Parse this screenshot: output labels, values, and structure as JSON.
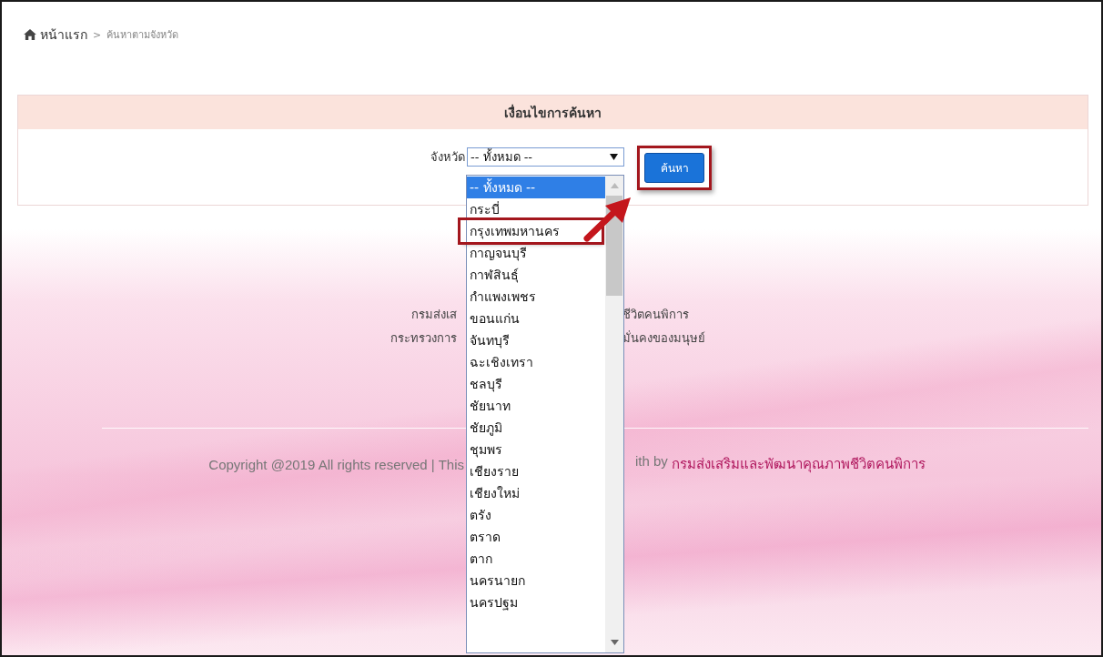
{
  "breadcrumb": {
    "items": [
      {
        "label": "หน้าแรก",
        "kind": "home"
      },
      {
        "label": "ค้นหาตามจังหวัด",
        "kind": "current"
      }
    ],
    "separator": ">"
  },
  "search_panel": {
    "title": "เงื่อนไขการค้นหา",
    "province_label": "จังหวัด",
    "select_value": "-- ทั้งหมด --",
    "button": {
      "label": "ค้นหา",
      "highlighted": true
    }
  },
  "dropdown": {
    "options": [
      {
        "label": "-- ทั้งหมด --",
        "selected": true,
        "highlighted": false
      },
      {
        "label": "กระบี่",
        "selected": false,
        "highlighted": false
      },
      {
        "label": "กรุงเทพมหานคร",
        "selected": false,
        "highlighted": true
      },
      {
        "label": "กาญจนบุรี",
        "selected": false,
        "highlighted": false
      },
      {
        "label": "กาฬสินธุ์",
        "selected": false,
        "highlighted": false
      },
      {
        "label": "กำแพงเพชร",
        "selected": false,
        "highlighted": false
      },
      {
        "label": "ขอนแก่น",
        "selected": false,
        "highlighted": false
      },
      {
        "label": "จันทบุรี",
        "selected": false,
        "highlighted": false
      },
      {
        "label": "ฉะเชิงเทรา",
        "selected": false,
        "highlighted": false
      },
      {
        "label": "ชลบุรี",
        "selected": false,
        "highlighted": false
      },
      {
        "label": "ชัยนาท",
        "selected": false,
        "highlighted": false
      },
      {
        "label": "ชัยภูมิ",
        "selected": false,
        "highlighted": false
      },
      {
        "label": "ชุมพร",
        "selected": false,
        "highlighted": false
      },
      {
        "label": "เชียงราย",
        "selected": false,
        "highlighted": false
      },
      {
        "label": "เชียงใหม่",
        "selected": false,
        "highlighted": false
      },
      {
        "label": "ตรัง",
        "selected": false,
        "highlighted": false
      },
      {
        "label": "ตราด",
        "selected": false,
        "highlighted": false
      },
      {
        "label": "ตาก",
        "selected": false,
        "highlighted": false
      },
      {
        "label": "นครนายก",
        "selected": false,
        "highlighted": false
      },
      {
        "label": "นครปฐม",
        "selected": false,
        "highlighted": false
      }
    ]
  },
  "footer": {
    "lines": [
      {
        "left": "กรมส่งเส",
        "right": "ชีวิตคนพิการ"
      },
      {
        "left": "กระทรวงการ",
        "right": "มั่นคงของมนุษย์"
      }
    ],
    "copyright_left": "Copyright @2019 All rights reserved | This",
    "copyright_right": "ith by",
    "copyright_link": "กรมส่งเสริมและพัฒนาคุณภาพชีวิตคนพิการ"
  }
}
